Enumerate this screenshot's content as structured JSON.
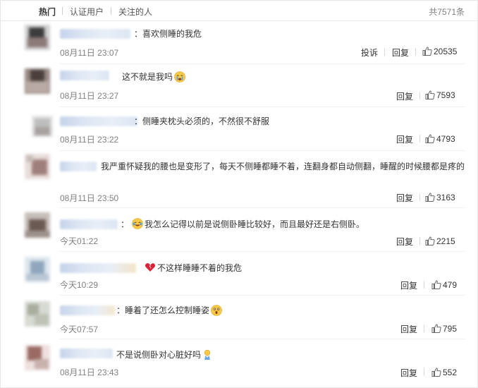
{
  "tabs": [
    {
      "label": "热门"
    },
    {
      "label": "认证用户"
    },
    {
      "label": "关注的人"
    }
  ],
  "total_count": "共7571条",
  "actions": {
    "report": "投诉",
    "reply": "回复"
  },
  "icons": {
    "like": "thumb-up-icon"
  },
  "comments": [
    {
      "prefix": "：",
      "text": "喜欢侧睡的我危",
      "emoji": "",
      "time": "08月11日 23:07",
      "likes": "20535"
    },
    {
      "prefix": "",
      "text": "这不就是我吗",
      "emoji": "crying-face-icon",
      "time": "08月11日 23:27",
      "likes": "7593"
    },
    {
      "prefix": "：",
      "text": "侧睡夹枕头必须的，不然很不舒服",
      "emoji": "",
      "time": "08月11日 23:22",
      "likes": "4793"
    },
    {
      "prefix": "",
      "text": "我严重怀疑我的腰也是变形了，每天不侧睡都睡不着，连翻身都自动侧翻，睡醒的时候腰都是疼的",
      "emoji": "",
      "time": "08月11日 23:50",
      "likes": "3163"
    },
    {
      "prefix": "：",
      "text": "我怎么记得以前是说侧卧睡比较好，而且最好还是右侧卧。",
      "emoji": "laughing-tears-icon",
      "time": "今天01:22",
      "likes": "2215"
    },
    {
      "prefix": "",
      "text": "不这样睡睡不着的我危",
      "emoji": "broken-heart-icon",
      "time": "今天10:29",
      "likes": "479"
    },
    {
      "prefix": "：",
      "text": "睡着了还怎么控制睡姿",
      "emoji": "shocked-face-icon",
      "time": "今天07:57",
      "likes": "795"
    },
    {
      "prefix": "",
      "text": "不是说侧卧对心脏好吗",
      "emoji": "praying-icon",
      "time": "08月11日 23:43",
      "likes": "552"
    }
  ]
}
